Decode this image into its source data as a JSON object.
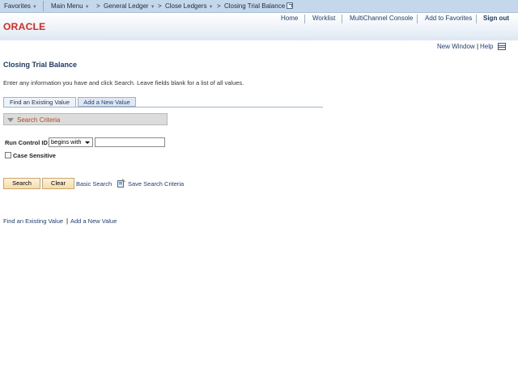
{
  "topnav": {
    "favorites": "Favorites",
    "main_menu": "Main Menu",
    "breadcrumb_arrow": ">",
    "general_ledger": "General Ledger",
    "close_ledgers": "Close Ledgers",
    "current_page": "Closing Trial Balance"
  },
  "header": {
    "logo": "ORACLE",
    "links": {
      "home": "Home",
      "worklist": "Worklist",
      "multichannel": "MultiChannel Console",
      "add_favorites": "Add to Favorites",
      "sign_out": "Sign out"
    }
  },
  "page_links": {
    "new_window": "New Window",
    "separator": "|",
    "help": "Help"
  },
  "page": {
    "title": "Closing Trial Balance",
    "instructions": "Enter any information you have and click Search. Leave fields blank for a list of all values."
  },
  "tabs": {
    "find_existing": "Find an Existing Value",
    "add_new": "Add a New Value"
  },
  "search_criteria": {
    "label": "Search Criteria",
    "run_control_label": "Run Control ID:",
    "operator": "begins with",
    "run_control_value": "",
    "case_sensitive_label": "Case Sensitive"
  },
  "buttons": {
    "search": "Search",
    "clear": "Clear",
    "basic_search": "Basic Search",
    "save_search_criteria": "Save Search Criteria"
  },
  "bottom_links": {
    "find_existing": "Find an Existing Value",
    "separator": "|",
    "add_new": "Add a New Value"
  }
}
